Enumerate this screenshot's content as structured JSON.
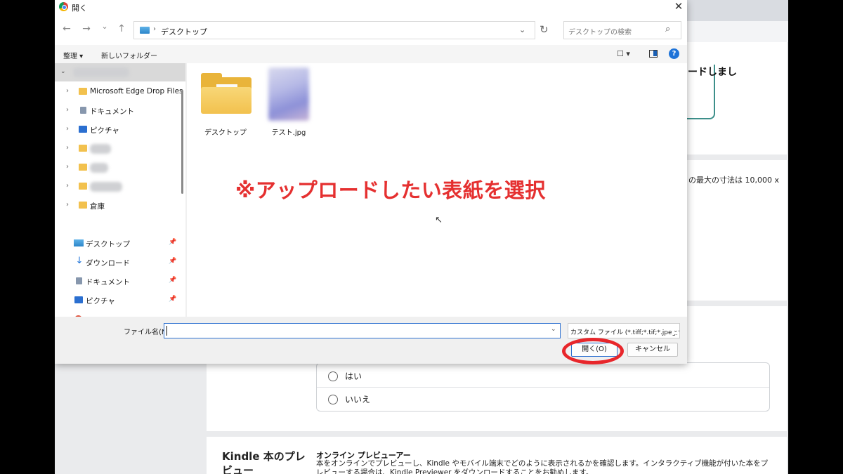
{
  "background": {
    "upload_box_text": "ロードしまし",
    "dimension_text": "の最大の寸法は 10,000 x",
    "radio_options": [
      "はい",
      "いいえ"
    ],
    "kindle_preview": {
      "title": "Kindle 本のプレビュー",
      "subtitle": "オンライン プレビューアー",
      "description": "本をオンラインでプレビューし、Kindle やモバイル端末でどのように表示されるかを確認します。インタラクティブ機能が付いた本をプレビューする場合は、Kindle Previewer をダウンロードすることをお勧めします。"
    }
  },
  "dialog": {
    "title": "開く",
    "close_symbol": "✕",
    "nav": {
      "back": "←",
      "forward": "→",
      "recent": "⌄",
      "up": "↑",
      "refresh": "↻"
    },
    "address": {
      "separator": "›",
      "path": "デスクトップ",
      "dropdown": "⌄"
    },
    "search": {
      "placeholder": "デスクトップの検索",
      "icon": "⌕"
    },
    "toolbar": {
      "organize": "整理 ▾",
      "new_folder": "新しいフォルダー",
      "view": "☐ ▾",
      "help": "?"
    },
    "sidebar": {
      "caret_expanded": "⌄",
      "tree": [
        {
          "label": "Microsoft Edge Drop Files",
          "icon": "folder-icon"
        },
        {
          "label": "ドキュメント",
          "icon": "document-icon"
        },
        {
          "label": "ピクチャ",
          "icon": "picture-icon"
        },
        {
          "label": "",
          "icon": "folder-icon"
        },
        {
          "label": "",
          "icon": "folder-icon"
        },
        {
          "label": "",
          "icon": "folder-icon"
        },
        {
          "label": "倉庫",
          "icon": "folder-icon"
        }
      ],
      "tree_caret": "›",
      "quick_access": [
        {
          "label": "デスクトップ",
          "icon": "desktop-icon"
        },
        {
          "label": "ダウンロード",
          "icon": "download-icon"
        },
        {
          "label": "ドキュメント",
          "icon": "document-icon"
        },
        {
          "label": "ピクチャ",
          "icon": "picture-icon"
        }
      ],
      "pin_symbol": "📌",
      "download_glyph": "↓"
    },
    "files": [
      {
        "name": "デスクトップ",
        "type": "folder"
      },
      {
        "name": "テスト.jpg",
        "type": "image"
      }
    ],
    "cursor_glyph": "↖",
    "bottom": {
      "filename_label": "ファイル名(N):",
      "filename_value": "",
      "filename_dropdown": "⌄",
      "filter": "カスタム ファイル (*.tiff;*.tif;*.jpeg;*.",
      "filter_dropdown": "⌄",
      "open_button": "開く(O)",
      "cancel_button": "キャンセル"
    }
  },
  "annotation": {
    "text": "※アップロードしたい表紙を選択",
    "color": "#e53030",
    "highlight_ring_color": "#e8262b"
  }
}
